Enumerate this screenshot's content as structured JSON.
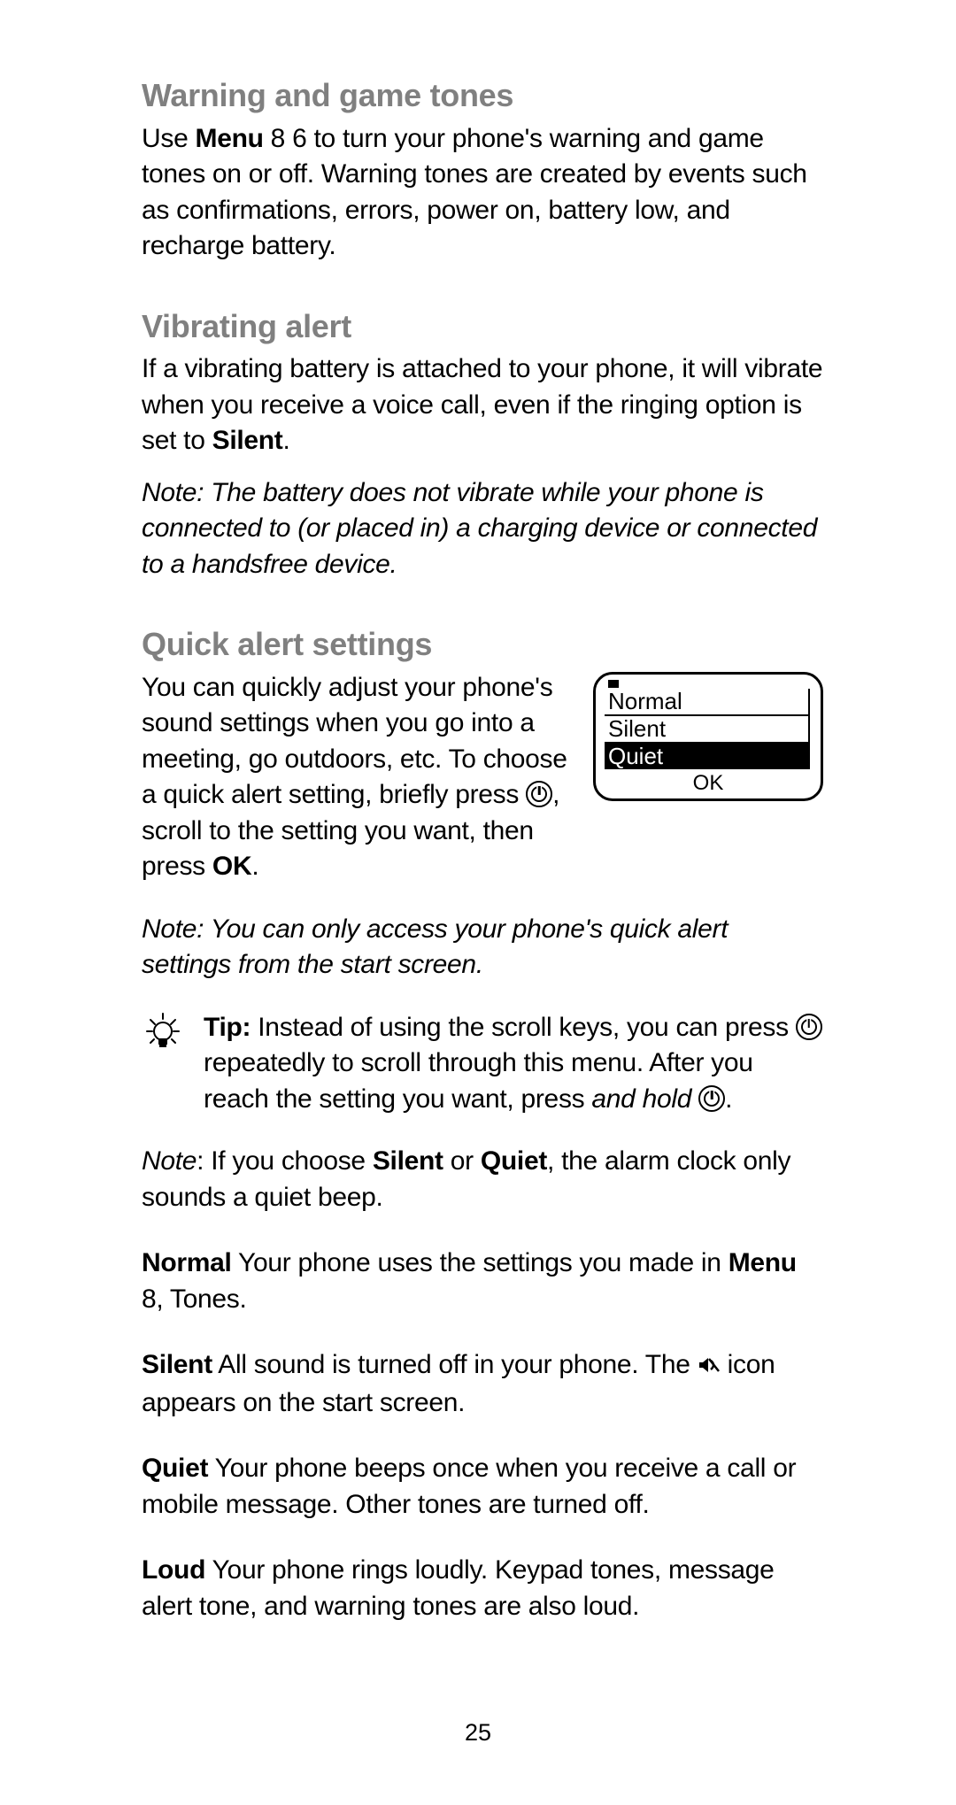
{
  "sections": {
    "warning": {
      "heading": "Warning and game tones",
      "para_pre": "Use ",
      "menu_bold": "Menu",
      "para_post": " 8 6 to turn your phone's warning and game tones on or off. Warning tones are created by events such as confirmations, errors, power on, battery low, and recharge battery."
    },
    "vibrating": {
      "heading": "Vibrating alert",
      "para_pre": "If a vibrating battery is attached to your phone, it will vibrate when you receive a voice call, even if the ringing option is set to ",
      "silent_bold": "Silent",
      "para_post": ".",
      "note": "Note:  The battery does not vibrate while your phone is connected to (or placed in) a charging device or connected to a handsfree device."
    },
    "quick": {
      "heading": "Quick alert settings",
      "para_a": "You can quickly adjust your phone's sound settings when you go into a meeting, go outdoors, etc. To choose a quick alert setting, briefly press ",
      "para_b": ", scroll to the setting you want, then press ",
      "ok_bold": "OK",
      "para_c": ".",
      "screen": {
        "r1": "Normal",
        "r2": "Silent",
        "r3": "Quiet",
        "ok": "OK"
      },
      "note2": "Note: You can only access your phone's quick alert settings from the start screen.",
      "tip_label": "Tip:",
      "tip_a": "  Instead of using the scroll keys, you can press ",
      "tip_b": " repeatedly to scroll through this menu. After you reach the setting you want, press ",
      "tip_hold": "and hold",
      "tip_c": " ",
      "tip_d": ".",
      "note3_pre": "Note",
      "note3_a": ": If you choose ",
      "note3_silent": "Silent",
      "note3_or": " or ",
      "note3_quiet": "Quiet",
      "note3_post": ", the alarm clock only sounds a quiet beep.",
      "defs": {
        "normal_label": "Normal",
        "normal_a": "  Your phone uses the settings you made in ",
        "normal_menu": "Menu",
        "normal_b": " 8, Tones.",
        "silent_label": "Silent",
        "silent_a": "  All sound is turned off in your phone. The  ",
        "silent_b": "  icon appears on the start screen.",
        "quiet_label": "Quiet",
        "quiet_a": "  Your phone beeps once when you receive a call or mobile message. Other tones are turned off.",
        "loud_label": "Loud",
        "loud_a": "  Your phone rings loudly. Keypad tones, message alert tone, and warning tones are also loud."
      }
    }
  },
  "page_number": "25"
}
